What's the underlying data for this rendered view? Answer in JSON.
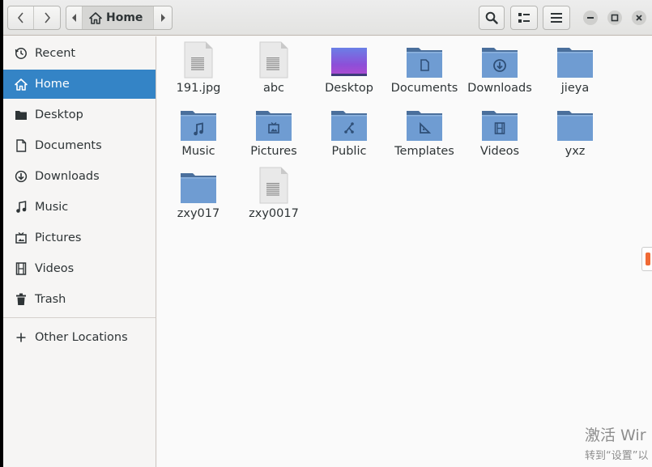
{
  "header": {
    "path": "Home"
  },
  "sidebar": {
    "items": [
      {
        "label": "Recent",
        "icon": "clock-icon"
      },
      {
        "label": "Home",
        "icon": "home-icon",
        "active": true
      },
      {
        "label": "Desktop",
        "icon": "folder-icon"
      },
      {
        "label": "Documents",
        "icon": "document-icon"
      },
      {
        "label": "Downloads",
        "icon": "download-icon"
      },
      {
        "label": "Music",
        "icon": "music-icon"
      },
      {
        "label": "Pictures",
        "icon": "picture-icon"
      },
      {
        "label": "Videos",
        "icon": "film-icon"
      },
      {
        "label": "Trash",
        "icon": "trash-icon"
      }
    ],
    "other_locations": "Other Locations"
  },
  "files": [
    {
      "name": "191.jpg",
      "type": "file"
    },
    {
      "name": "abc",
      "type": "file"
    },
    {
      "name": "Desktop",
      "type": "desktop"
    },
    {
      "name": "Documents",
      "type": "folder-documents"
    },
    {
      "name": "Downloads",
      "type": "folder-downloads"
    },
    {
      "name": "jieya",
      "type": "folder"
    },
    {
      "name": "Music",
      "type": "folder-music"
    },
    {
      "name": "Pictures",
      "type": "folder-pictures"
    },
    {
      "name": "Public",
      "type": "folder-public"
    },
    {
      "name": "Templates",
      "type": "folder-templates"
    },
    {
      "name": "Videos",
      "type": "folder-videos"
    },
    {
      "name": "yxz",
      "type": "folder"
    },
    {
      "name": "zxy017",
      "type": "folder"
    },
    {
      "name": "zxy0017",
      "type": "file"
    }
  ],
  "watermark": {
    "line1": "激活 Wir",
    "line2": "转到“设置”以"
  },
  "colors": {
    "accent": "#3484c6",
    "folder": "#6f9cd2",
    "folder_tab": "#4a6f9c"
  }
}
